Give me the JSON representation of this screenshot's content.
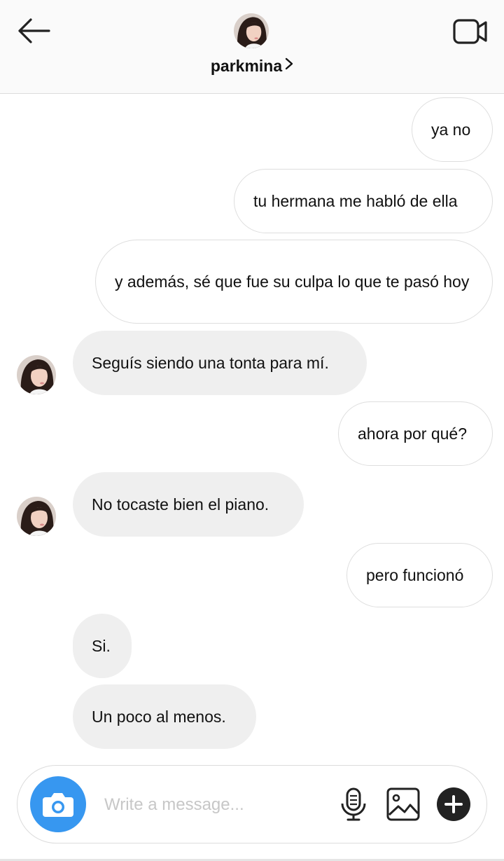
{
  "header": {
    "username": "parkmina",
    "icons": {
      "back": "back-arrow-icon",
      "video": "video-call-icon",
      "chevron": "chevron-right-icon"
    }
  },
  "messages": [
    {
      "side": "sent",
      "text": "ya no"
    },
    {
      "side": "sent",
      "text": "tu hermana me habló de ella"
    },
    {
      "side": "sent",
      "text": "y además, sé que fue su culpa lo que te pasó hoy"
    },
    {
      "side": "received",
      "text": "Seguís siendo una tonta para mí."
    },
    {
      "side": "sent",
      "text": "ahora por qué?"
    },
    {
      "side": "received",
      "text": "No tocaste bien el piano."
    },
    {
      "side": "sent",
      "text": "pero funcionó"
    },
    {
      "side": "received",
      "text": "Si."
    },
    {
      "side": "received",
      "text": "Un poco al menos."
    }
  ],
  "composer": {
    "placeholder": "Write a message...",
    "value": "",
    "icons": [
      "camera-icon",
      "microphone-icon",
      "gallery-icon",
      "plus-icon"
    ]
  },
  "colors": {
    "accent": "#3797f0",
    "received_bubble": "#efefef",
    "sent_border": "#dedede"
  }
}
